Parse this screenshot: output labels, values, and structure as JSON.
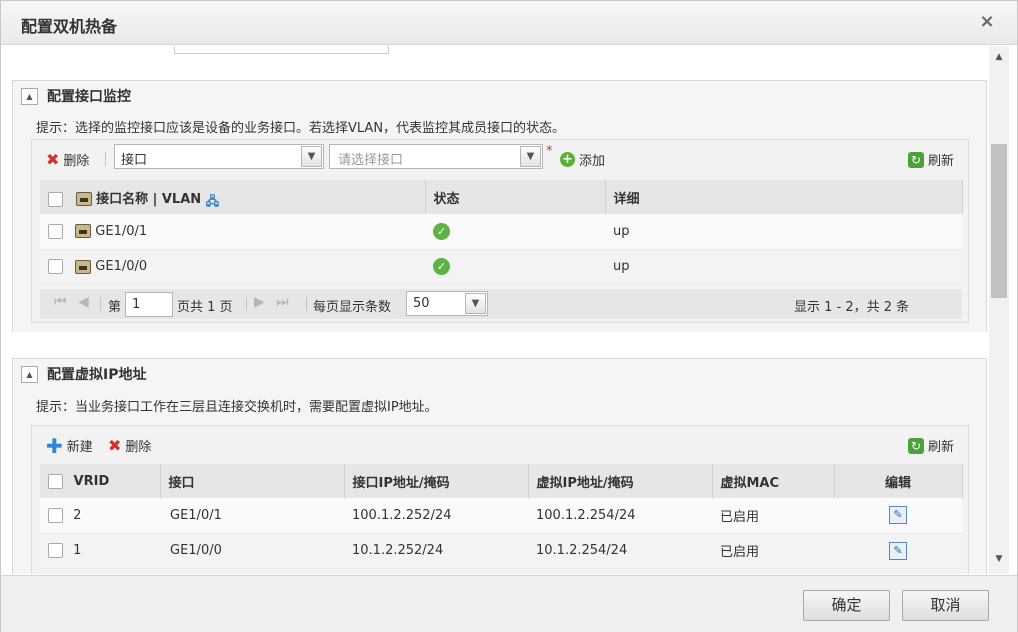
{
  "dialog": {
    "title": "配置双机热备",
    "close_glyph": "×"
  },
  "monitor": {
    "title": "配置接口监控",
    "hint": "提示：选择的监控接口应该是设备的业务接口。若选择VLAN，代表监控其成员接口的状态。",
    "toolbar": {
      "delete_label": "删除",
      "type_value": "接口",
      "iface_placeholder": "请选择接口",
      "required_mark": "*",
      "add_label": "添加",
      "refresh_label": "刷新"
    },
    "columns": [
      "接口名称 | VLAN",
      "状态",
      "详细"
    ],
    "rows": [
      {
        "name": "GE1/0/1",
        "status": "ok",
        "detail": "up"
      },
      {
        "name": "GE1/0/0",
        "status": "ok",
        "detail": "up"
      }
    ],
    "pager": {
      "page_prefix": "第",
      "page": "1",
      "page_suffix": "页共 1 页",
      "per_page_label": "每页显示条数",
      "per_page": "50",
      "summary": "显示 1 - 2，共 2 条"
    }
  },
  "vip": {
    "title": "配置虚拟IP地址",
    "hint": "提示：当业务接口工作在三层且连接交换机时，需要配置虚拟IP地址。",
    "toolbar": {
      "new_label": "新建",
      "delete_label": "删除",
      "refresh_label": "刷新"
    },
    "columns": [
      "VRID",
      "接口",
      "接口IP地址/掩码",
      "虚拟IP地址/掩码",
      "虚拟MAC",
      "编辑"
    ],
    "rows": [
      {
        "vrid": "2",
        "iface": "GE1/0/1",
        "ip": "100.1.2.252/24",
        "vip": "100.1.2.254/24",
        "mac": "已启用"
      },
      {
        "vrid": "1",
        "iface": "GE1/0/0",
        "ip": "10.1.2.252/24",
        "vip": "10.1.2.254/24",
        "mac": "已启用"
      }
    ]
  },
  "footer": {
    "ok_label": "确定",
    "cancel_label": "取消"
  }
}
